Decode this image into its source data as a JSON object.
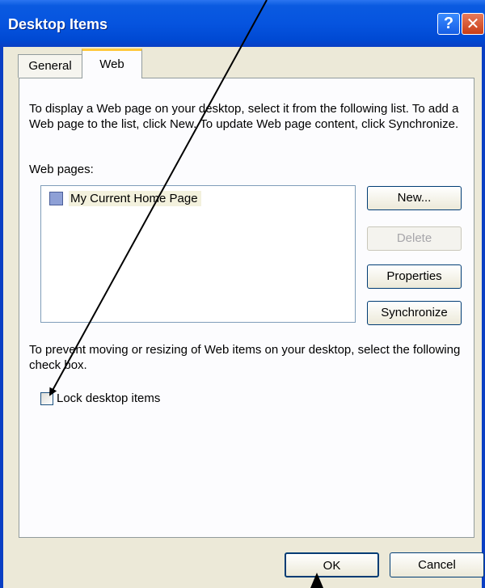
{
  "window": {
    "title": "Desktop Items",
    "help_glyph": "?",
    "close_glyph": "✕"
  },
  "tabs": [
    {
      "label": "General"
    },
    {
      "label": "Web"
    }
  ],
  "web_tab": {
    "description": "To display a Web page on your desktop, select it from the following list. To add a Web page to the list, click New.  To update Web page content, click Synchronize.",
    "list_label": "Web pages:",
    "items": [
      {
        "label": "My Current Home Page",
        "checked": false
      }
    ],
    "buttons": {
      "new": "New...",
      "delete": "Delete",
      "properties": "Properties",
      "synchronize": "Synchronize"
    },
    "lock_description": "To prevent moving or resizing of Web items on your desktop, select the following check box.",
    "lock_label": "Lock desktop items",
    "lock_checked": false
  },
  "footer": {
    "ok": "OK",
    "cancel": "Cancel"
  },
  "colors": {
    "titlebar": "#0654df",
    "dialog_bg": "#ece9d8",
    "tab_accent": "#ffc83c",
    "arrow": "#000000"
  },
  "annotations": [
    "arrow-to-lock-checkbox",
    "arrow-to-ok-button"
  ]
}
